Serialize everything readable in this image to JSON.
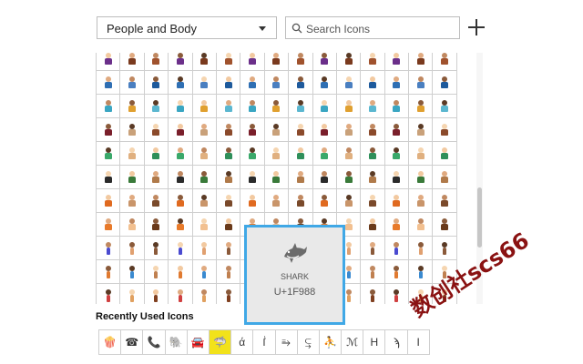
{
  "category_select": {
    "selected": "People and Body"
  },
  "search": {
    "placeholder": "Search Icons",
    "value": ""
  },
  "add_button": {
    "icon": "plus-icon"
  },
  "preview": {
    "name": "SHARK",
    "code": "U+1F988",
    "icon": "shark-icon",
    "border_color": "#40a8e6"
  },
  "recent": {
    "title": "Recently Used Icons",
    "items": [
      {
        "icon": "popcorn-icon",
        "glyph": "🍿"
      },
      {
        "icon": "telephone-icon",
        "glyph": "☎"
      },
      {
        "icon": "telephone-receiver-icon",
        "glyph": "📞"
      },
      {
        "icon": "elephant-icon",
        "glyph": "🐘"
      },
      {
        "icon": "car-icon",
        "glyph": "🚘"
      },
      {
        "icon": "shark-icon",
        "glyph": "🦈",
        "selected": true
      },
      {
        "icon": "alpha-icon",
        "glyph": "ά"
      },
      {
        "icon": "symbol-icon",
        "glyph": "ẛ"
      },
      {
        "icon": "symbol-icon",
        "glyph": "⥱"
      },
      {
        "icon": "symbol-icon",
        "glyph": "⥹"
      },
      {
        "icon": "person-icon",
        "glyph": "⛹"
      },
      {
        "icon": "music-icon",
        "glyph": "ℳ"
      },
      {
        "icon": "letter-h-icon",
        "glyph": "H"
      },
      {
        "icon": "symbol-icon",
        "glyph": "ϡ"
      },
      {
        "icon": "symbol-icon",
        "glyph": "I"
      }
    ]
  },
  "watermark": "数创社scs66",
  "colors": {
    "selection_yellow": "#f2e21a",
    "preview_border": "#40a8e6",
    "grid_line": "#cfcfcf",
    "row_palettes": [
      [
        "#6b2f8a",
        "#7a3a1e",
        "#a0522d"
      ],
      [
        "#2f6fb3",
        "#4a7fc0",
        "#1e5a9c"
      ],
      [
        "#3aa6c2",
        "#e0a030",
        "#5bb7d0"
      ],
      [
        "#7a1f2b",
        "#c9a17a",
        "#8b4a2b"
      ],
      [
        "#3aa86a",
        "#e0b080",
        "#2f8f5a"
      ],
      [
        "#2b2b2b",
        "#3a7a3a",
        "#b07a4a"
      ],
      [
        "#e06a20",
        "#c9956a",
        "#7a4a2b"
      ],
      [
        "#e87a2a",
        "#f2c090",
        "#6a3a1a"
      ],
      [
        "#4a4ad0",
        "#e0a070",
        "#8b5a3a"
      ],
      [
        "#e07a30",
        "#3a8ad0",
        "#c08050"
      ],
      [
        "#d04040",
        "#e0a060",
        "#804020"
      ]
    ]
  }
}
